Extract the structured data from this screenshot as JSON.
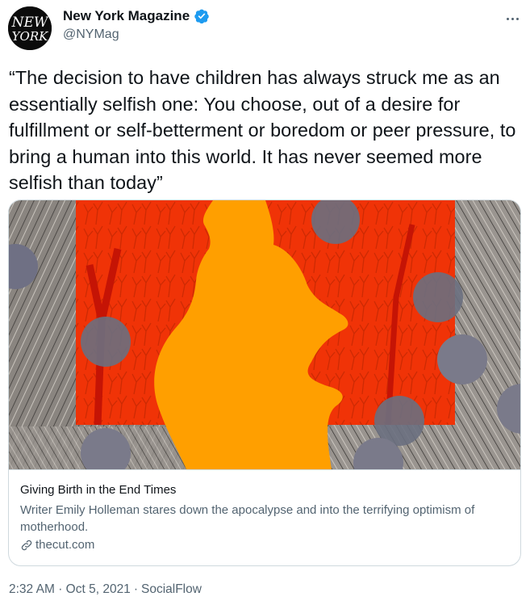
{
  "author": {
    "avatar_text_top": "NEW",
    "avatar_text_bottom": "YORK",
    "display_name": "New York Magazine",
    "handle": "@NYMag",
    "verified": true,
    "avatar_icon": "nymag-logo"
  },
  "more_icon": "more-horizontal-icon",
  "tweet": {
    "text": "“The decision to have children has always struck me as an essentially selfish one: You choose, out of a desire for fulfillment or self-betterment or boredom or peer pressure, to bring a human into this world. It has never seemed more selfish than today”"
  },
  "card": {
    "image_description_icon": "pregnant-silhouette-illustration",
    "title": "Giving Birth in the End Times",
    "description": "Writer Emily Holleman stares down the apocalypse and into the terrifying optimism of motherhood.",
    "domain": "thecut.com",
    "domain_icon": "link-icon"
  },
  "footer": {
    "time": "2:32 AM",
    "separator1": "·",
    "date": "Oct 5, 2021",
    "separator2": "·",
    "source": "SocialFlow"
  },
  "colors": {
    "text": "#0f1419",
    "secondary": "#536471",
    "border": "#cfd9de",
    "verified": "#1d9bf0",
    "orange_silhouette": "#ff9f00",
    "red_background": "#e8200c"
  }
}
